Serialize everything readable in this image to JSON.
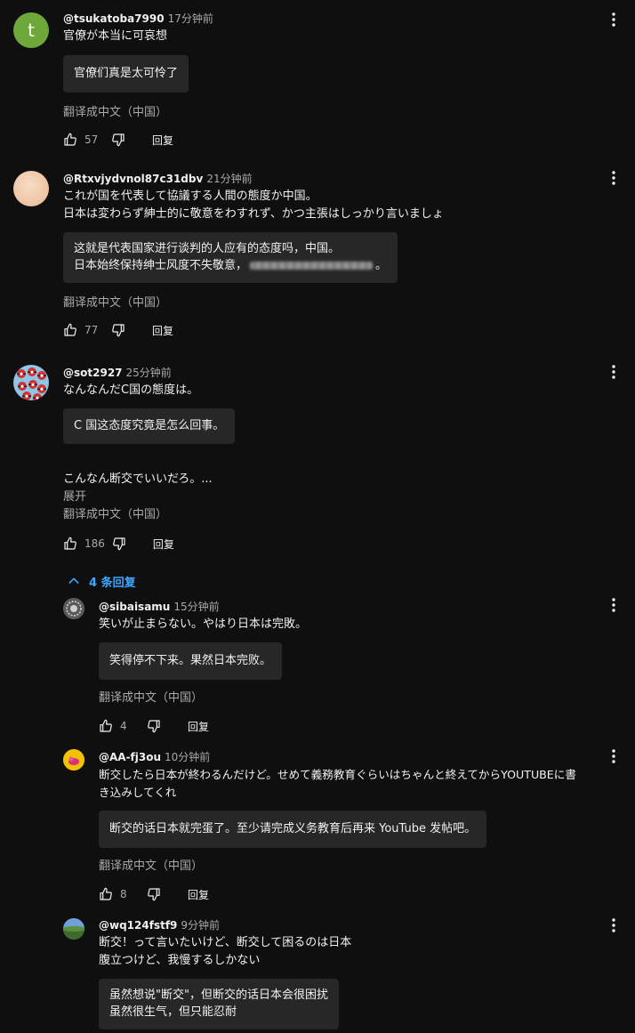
{
  "comments": [
    {
      "author": "@tsukatoba7990",
      "time": "17分钟前",
      "avatar_letter": "t",
      "avatar_color": "#6fa83a",
      "lines": [
        "官僚が本当に可哀想"
      ],
      "translation": [
        "官僚们真是太可怜了"
      ],
      "translate_link": "翻译成中文（中国）",
      "likes": "57",
      "reply_label": "回复"
    },
    {
      "author": "@Rtxvjydvnol87c31dbv",
      "time": "21分钟前",
      "avatar_color": "#f1cdb0",
      "lines": [
        "これが国を代表して協議する人間の態度か中国。",
        "日本は変わらず紳士的に敬意をわすれず、かつ主張はしっかり言いましょ"
      ],
      "translation_line1": "这就是代表国家进行谈判的人应有的态度吗，中国。",
      "translation_line2_prefix": "日本始终保持绅士风度不失敬意，",
      "translation_line2_suffix": "。",
      "translate_link": "翻译成中文（中国）",
      "likes": "77",
      "reply_label": "回复"
    },
    {
      "author": "@sot2927",
      "time": "25分钟前",
      "avatar_color": "#8fc6e8",
      "lines": [
        "なんなんだC国の態度は。"
      ],
      "translation": [
        "C 国这态度究竟是怎么回事。"
      ],
      "extra_line": "こんなん断交でいいだろ。...",
      "expand_label": "展开",
      "translate_link": "翻译成中文（中国）",
      "likes": "186",
      "reply_label": "回复"
    }
  ],
  "replies_toggle": "4 条回复",
  "replies": [
    {
      "author": "@sibaisamu",
      "time": "15分钟前",
      "avatar_color": "#7a7a7a",
      "lines": [
        "笑いが止まらない。やはり日本は完敗。"
      ],
      "translation": [
        "笑得停不下来。果然日本完败。"
      ],
      "translate_link": "翻译成中文（中国）",
      "likes": "4",
      "reply_label": "回复"
    },
    {
      "author": "@AA-fj3ou",
      "time": "10分钟前",
      "avatar_color": "#f2c200",
      "lines": [
        "断交したら日本が終わるんだけど。せめて義務教育ぐらいはちゃんと終えてからYOUTUBEに書",
        "き込みしてくれ"
      ],
      "translation": [
        "断交的话日本就完蛋了。至少请完成义务教育后再来 YouTube 发帖吧。"
      ],
      "translate_link": "翻译成中文（中国）",
      "likes": "8",
      "reply_label": "回复"
    },
    {
      "author": "@wq124fstf9",
      "time": "9分钟前",
      "avatar_color": "#4a7db8",
      "lines": [
        "断交！って言いたいけど、断交して困るのは日本",
        "腹立つけど、我慢するしかない"
      ],
      "translation": [
        "虽然想说\"断交\"，但断交的话日本会很困扰",
        "虽然很生气，但只能忍耐"
      ]
    }
  ],
  "colors": {
    "background": "#0f0f0f",
    "box": "#272727",
    "link_blue": "#3ea6ff",
    "muted": "#aaaaaa"
  },
  "icons": [
    "more-vert-icon",
    "thumb-up-icon",
    "thumb-down-icon",
    "chevron-up-icon"
  ]
}
